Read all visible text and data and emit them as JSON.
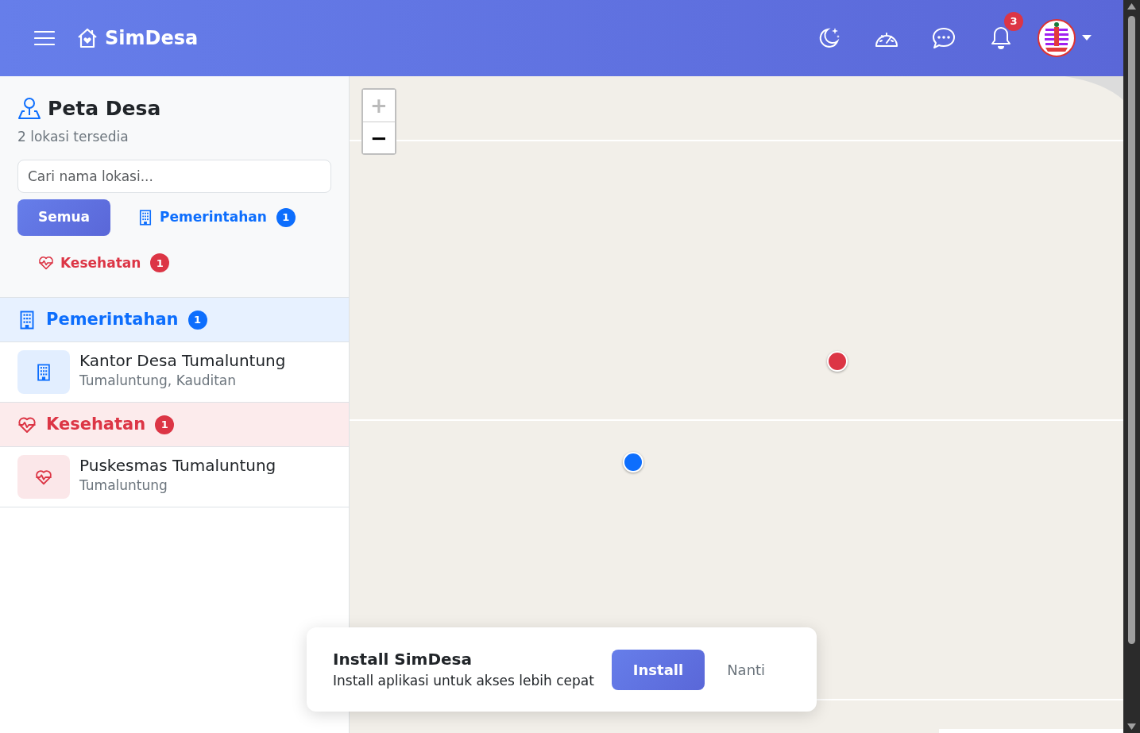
{
  "navbar": {
    "brand": "SimDesa",
    "notification_count": "3"
  },
  "sidebar": {
    "title": "Peta Desa",
    "subtitle": "2 lokasi tersedia",
    "search": {
      "placeholder": "Cari nama lokasi..."
    },
    "filters": [
      {
        "label": "Semua",
        "kind": "all",
        "selected": true
      },
      {
        "label": "Pemerintahan",
        "kind": "government",
        "count": "1",
        "color": "#0d6efd",
        "selected": false
      },
      {
        "label": "Kesehatan",
        "kind": "health",
        "count": "1",
        "color": "#dc3545",
        "selected": false
      }
    ],
    "groups": [
      {
        "label": "Pemerintahan",
        "kind": "government",
        "count": "1",
        "color": "#0d6efd",
        "locations": [
          {
            "name": "Kantor Desa Tumaluntung",
            "address": "Tumaluntung, Kauditan"
          }
        ]
      },
      {
        "label": "Kesehatan",
        "kind": "health",
        "count": "1",
        "color": "#dc3545",
        "locations": [
          {
            "name": "Puskesmas Tumaluntung",
            "address": "Tumaluntung"
          }
        ]
      }
    ]
  },
  "map": {
    "zoom_controls": [
      {
        "label": "+",
        "disabled": true
      },
      {
        "label": "−",
        "disabled": false
      }
    ],
    "markers": [
      {
        "color": "#dc3545"
      },
      {
        "color": "#0d6efd"
      }
    ]
  },
  "install_prompt": {
    "title": "Install SimDesa",
    "message": "Install aplikasi untuk akses lebih cepat",
    "buttons": [
      "Install",
      "Nanti"
    ]
  }
}
